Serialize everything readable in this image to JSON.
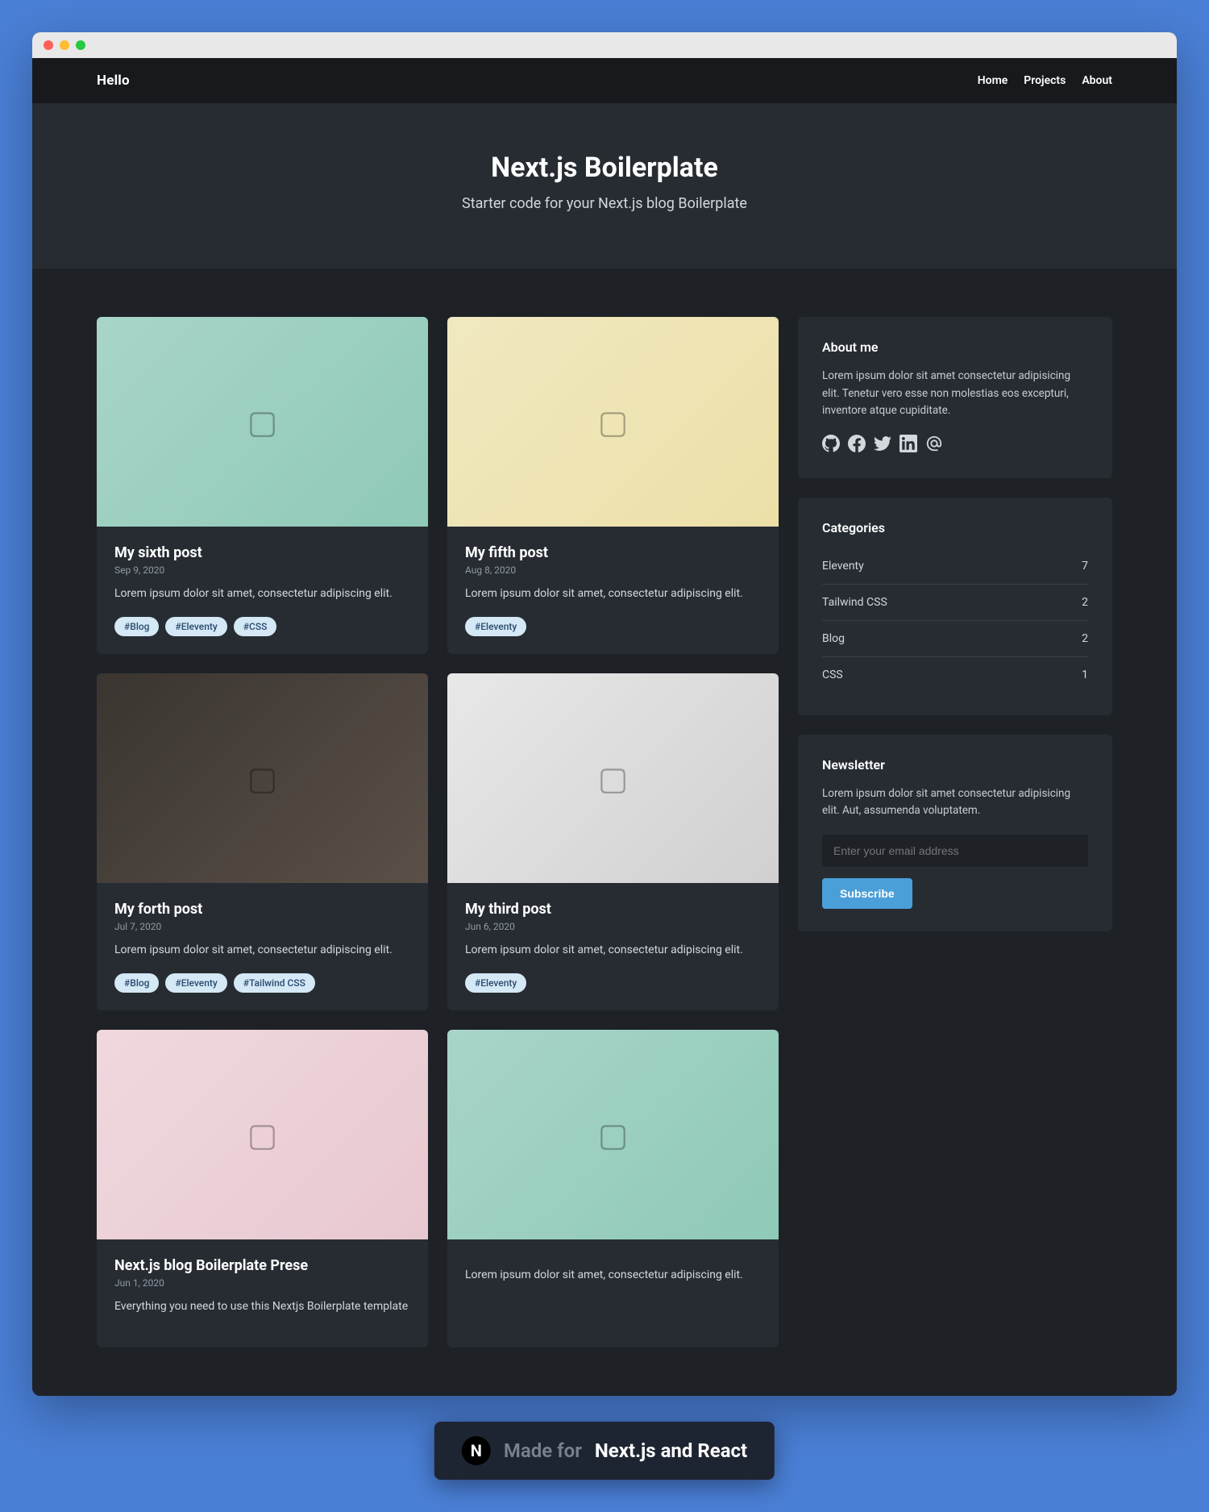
{
  "brand": "Hello",
  "nav": [
    {
      "label": "Home"
    },
    {
      "label": "Projects"
    },
    {
      "label": "About"
    }
  ],
  "hero": {
    "title": "Next.js Boilerplate",
    "subtitle": "Starter code for your Next.js blog Boilerplate"
  },
  "posts": [
    {
      "title": "My sixth post",
      "date": "Sep 9, 2020",
      "excerpt": "Lorem ipsum dolor sit amet, consectetur adipiscing elit.",
      "tags": [
        "#Blog",
        "#Eleventy",
        "#CSS"
      ],
      "thumb": "t1"
    },
    {
      "title": "My fifth post",
      "date": "Aug 8, 2020",
      "excerpt": "Lorem ipsum dolor sit amet, consectetur adipiscing elit.",
      "tags": [
        "#Eleventy"
      ],
      "thumb": "t2"
    },
    {
      "title": "My forth post",
      "date": "Jul 7, 2020",
      "excerpt": "Lorem ipsum dolor sit amet, consectetur adipiscing elit.",
      "tags": [
        "#Blog",
        "#Eleventy",
        "#Tailwind CSS"
      ],
      "thumb": "t3"
    },
    {
      "title": "My third post",
      "date": "Jun 6, 2020",
      "excerpt": "Lorem ipsum dolor sit amet, consectetur adipiscing elit.",
      "tags": [
        "#Eleventy"
      ],
      "thumb": "t4"
    },
    {
      "title": "Next.js blog Boilerplate Prese",
      "date": "Jun 1, 2020",
      "excerpt": "Everything you need to use this Nextjs Boilerplate template",
      "tags": [],
      "thumb": "t5"
    },
    {
      "title": "",
      "date": "",
      "excerpt": "Lorem ipsum dolor sit amet, consectetur adipiscing elit.",
      "tags": [],
      "thumb": "t6"
    }
  ],
  "about": {
    "title": "About me",
    "text": "Lorem ipsum dolor sit amet consectetur adipisicing elit. Tenetur vero esse non molestias eos excepturi, inventore atque cupiditate."
  },
  "categories": {
    "title": "Categories",
    "items": [
      {
        "name": "Eleventy",
        "count": "7"
      },
      {
        "name": "Tailwind CSS",
        "count": "2"
      },
      {
        "name": "Blog",
        "count": "2"
      },
      {
        "name": "CSS",
        "count": "1"
      }
    ]
  },
  "newsletter": {
    "title": "Newsletter",
    "text": "Lorem ipsum dolor sit amet consectetur adipisicing elit. Aut, assumenda voluptatem.",
    "placeholder": "Enter your email address",
    "button": "Subscribe"
  },
  "badge": {
    "icon": "N",
    "made": "Made for",
    "target": "Next.js and React"
  }
}
